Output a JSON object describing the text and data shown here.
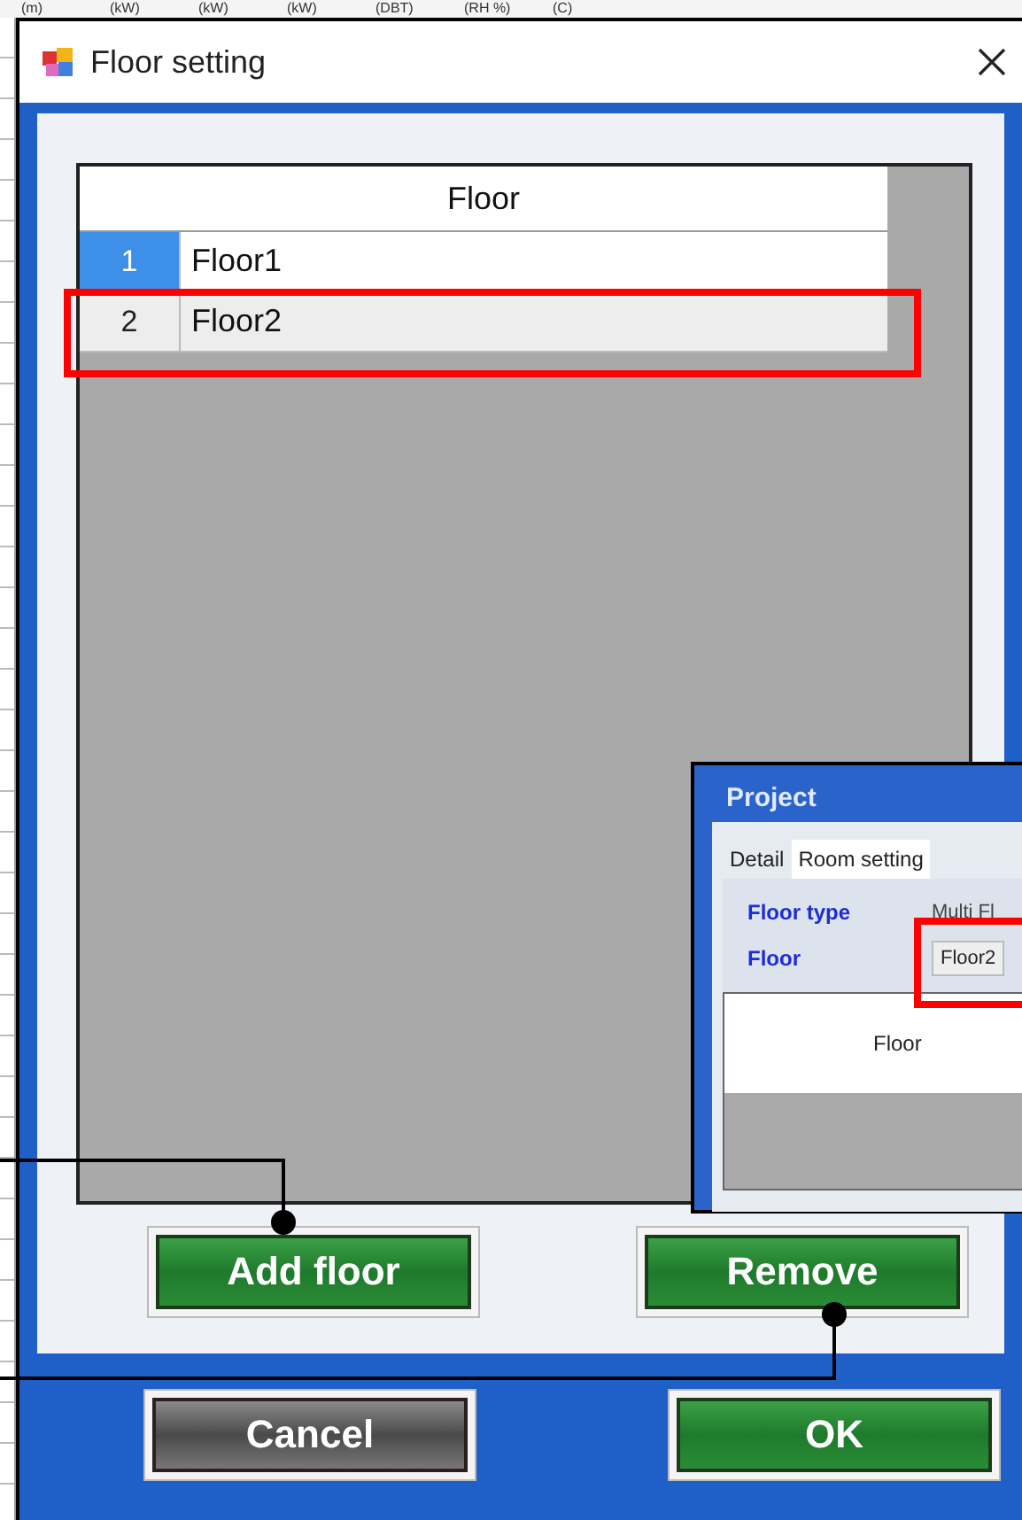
{
  "background_sheet": {
    "units": [
      "(m)",
      "(kW)",
      "(kW)",
      "(kW)",
      "(DBT)",
      "(RH %)",
      "(C)"
    ]
  },
  "dialog": {
    "title": "Floor setting"
  },
  "grid": {
    "header": "Floor",
    "rows": [
      {
        "number": "1",
        "name": "Floor1",
        "selected": true
      },
      {
        "number": "2",
        "name": "Floor2",
        "selected": false
      }
    ]
  },
  "actions": [
    {
      "label": "Add floor",
      "kind": "primary"
    },
    {
      "label": "Remove",
      "kind": "primary"
    }
  ],
  "footer_buttons": [
    {
      "label": "Cancel",
      "kind": "neutral"
    },
    {
      "label": "OK",
      "kind": "primary"
    }
  ],
  "inset": {
    "title": "Project",
    "tabs": [
      {
        "label": "Detail",
        "selected": false
      },
      {
        "label": "Room setting",
        "selected": true
      }
    ],
    "fields": [
      {
        "label": "Floor type",
        "value": "Multi Fl",
        "kind": "text"
      },
      {
        "label": "Floor",
        "value": "Floor2",
        "kind": "box"
      }
    ],
    "grid_header": "Floor"
  }
}
